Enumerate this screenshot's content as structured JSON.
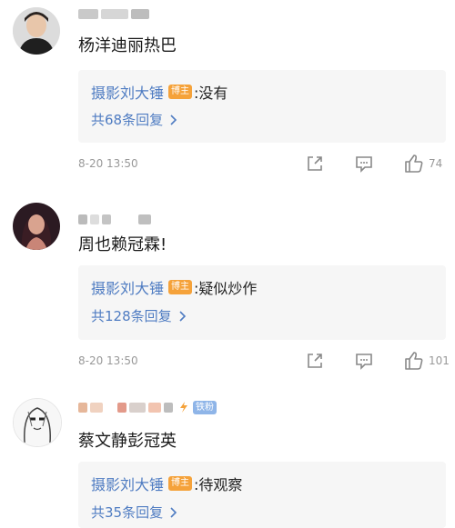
{
  "comments": [
    {
      "content": "杨洋迪丽热巴",
      "reply": {
        "blogger": "摄影刘大锤",
        "badge": "博主",
        "text": ":没有",
        "count_label": "共68条回复"
      },
      "time": "8-20 13:50",
      "likes": "74",
      "avatar_icon": "avatar-man-icon"
    },
    {
      "content": "周也赖冠霖!",
      "reply": {
        "blogger": "摄影刘大锤",
        "badge": "博主",
        "text": ":疑似炒作",
        "count_label": "共128条回复"
      },
      "time": "8-20 13:50",
      "likes": "101",
      "avatar_icon": "avatar-woman-icon"
    },
    {
      "content": "蔡文静彭冠英",
      "fan_badge": "铁粉",
      "reply": {
        "blogger": "摄影刘大锤",
        "badge": "博主",
        "text": ":待观察",
        "count_label": "共35条回复"
      },
      "avatar_icon": "avatar-sketch-icon"
    }
  ],
  "icons": {
    "share": "share-icon",
    "comment": "comment-icon",
    "like": "thumbs-up-icon",
    "chevron": "chevron-right-icon"
  },
  "colors": {
    "link": "#4f7cc2",
    "badge": "#f5a23a",
    "fan_badge": "#8fb5e8",
    "reply_bg": "#f6f6f6",
    "meta": "#999999"
  }
}
